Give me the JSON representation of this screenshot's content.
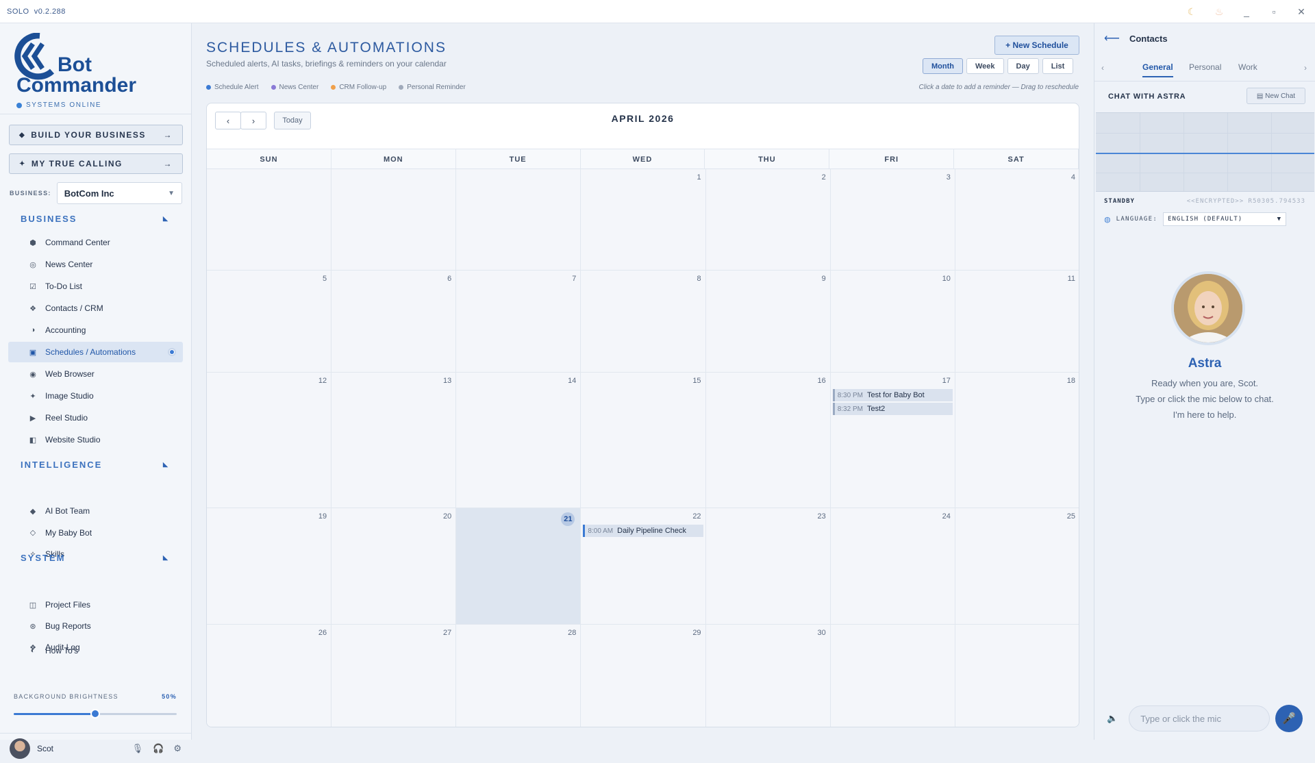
{
  "app": {
    "title": "SOLO",
    "version": "v0.2.288"
  },
  "sidebar": {
    "brand_line1": "Bot",
    "brand_line2": "Commander",
    "status": "SYSTEMS ONLINE",
    "build_button": "BUILD YOUR BUSINESS",
    "calling_button": "MY TRUE CALLING",
    "business_label": "BUSINESS:",
    "business_value": "BotCom Inc",
    "sections": {
      "business": "BUSINESS",
      "intelligence": "INTELLIGENCE",
      "system": "SYSTEM"
    },
    "business_items": [
      {
        "label": "Command Center",
        "icon": "hexagon-icon"
      },
      {
        "label": "News Center",
        "icon": "radio-icon"
      },
      {
        "label": "To-Do List",
        "icon": "checkbox-icon"
      },
      {
        "label": "Contacts / CRM",
        "icon": "diamond-icon"
      },
      {
        "label": "Accounting",
        "icon": "half-circle-icon"
      },
      {
        "label": "Schedules / Automations",
        "icon": "calendar-icon"
      },
      {
        "label": "Web Browser",
        "icon": "globe-icon"
      },
      {
        "label": "Image Studio",
        "icon": "sparkle-icon"
      },
      {
        "label": "Reel Studio",
        "icon": "play-icon"
      },
      {
        "label": "Website Studio",
        "icon": "layout-icon"
      }
    ],
    "intelligence_items": [
      {
        "label": "AI Bot Team",
        "icon": "diamond-solid-icon"
      },
      {
        "label": "My Baby Bot",
        "icon": "diamond-outline-icon"
      },
      {
        "label": "Skills",
        "icon": "small-diamond-icon"
      }
    ],
    "system_items": [
      {
        "label": "Project Files",
        "icon": "folder-icon"
      },
      {
        "label": "Bug Reports",
        "icon": "bug-icon"
      },
      {
        "label": "Audit Log",
        "icon": "log-icon"
      }
    ],
    "howto": "How To's",
    "brightness_label": "BACKGROUND BRIGHTNESS",
    "brightness_value": "50%",
    "brightness": 0.5,
    "user_name": "Scot"
  },
  "main": {
    "title": "SCHEDULES & AUTOMATIONS",
    "subtitle": "Scheduled alerts, AI tasks, briefings & reminders on your calendar",
    "new_button": "+ New Schedule",
    "views": [
      "Month",
      "Week",
      "Day",
      "List"
    ],
    "active_view": "Month",
    "legend": [
      {
        "label": "Schedule Alert",
        "color": "#3b7ad3"
      },
      {
        "label": "News Center",
        "color": "#8a7ad6"
      },
      {
        "label": "CRM Follow-up",
        "color": "#f0a04b"
      },
      {
        "label": "Personal Reminder",
        "color": "#a0aabb"
      }
    ],
    "hint": "Click a date to add a reminder — Drag to reschedule",
    "today_button": "Today",
    "month_label": "APRIL 2026",
    "weekdays": [
      "SUN",
      "MON",
      "TUE",
      "WED",
      "THU",
      "FRI",
      "SAT"
    ],
    "weeks": [
      [
        "",
        "",
        "",
        "1",
        "2",
        "3",
        "4"
      ],
      [
        "5",
        "6",
        "7",
        "8",
        "9",
        "10",
        "11"
      ],
      [
        "12",
        "13",
        "14",
        "15",
        "16",
        "17",
        "18"
      ],
      [
        "19",
        "20",
        "21",
        "22",
        "23",
        "24",
        "25"
      ],
      [
        "26",
        "27",
        "28",
        "29",
        "30",
        "",
        ""
      ]
    ],
    "today": "21",
    "events": [
      {
        "day": "17",
        "time": "8:30 PM",
        "title": "Test for Baby Bot"
      },
      {
        "day": "17",
        "time": "8:32 PM",
        "title": "Test2"
      },
      {
        "day": "22",
        "time": "8:00 AM",
        "title": "Daily Pipeline Check"
      }
    ]
  },
  "right": {
    "header": "Contacts",
    "tabs": [
      "General",
      "Personal",
      "Work"
    ],
    "active_tab": "General",
    "chat_title": "CHAT WITH ASTRA",
    "new_chat": "New Chat",
    "standby": "STANDBY",
    "encrypted": "<<ENCRYPTED>> R50305.794533",
    "language_label": "LANGUAGE:",
    "language_value": "ENGLISH (DEFAULT)",
    "assistant_name": "Astra",
    "msg1": "Ready when you are, Scot.",
    "msg2": "Type or click the mic below to chat.",
    "msg3": "I'm here to help.",
    "input_placeholder": "Type or click the mic"
  }
}
